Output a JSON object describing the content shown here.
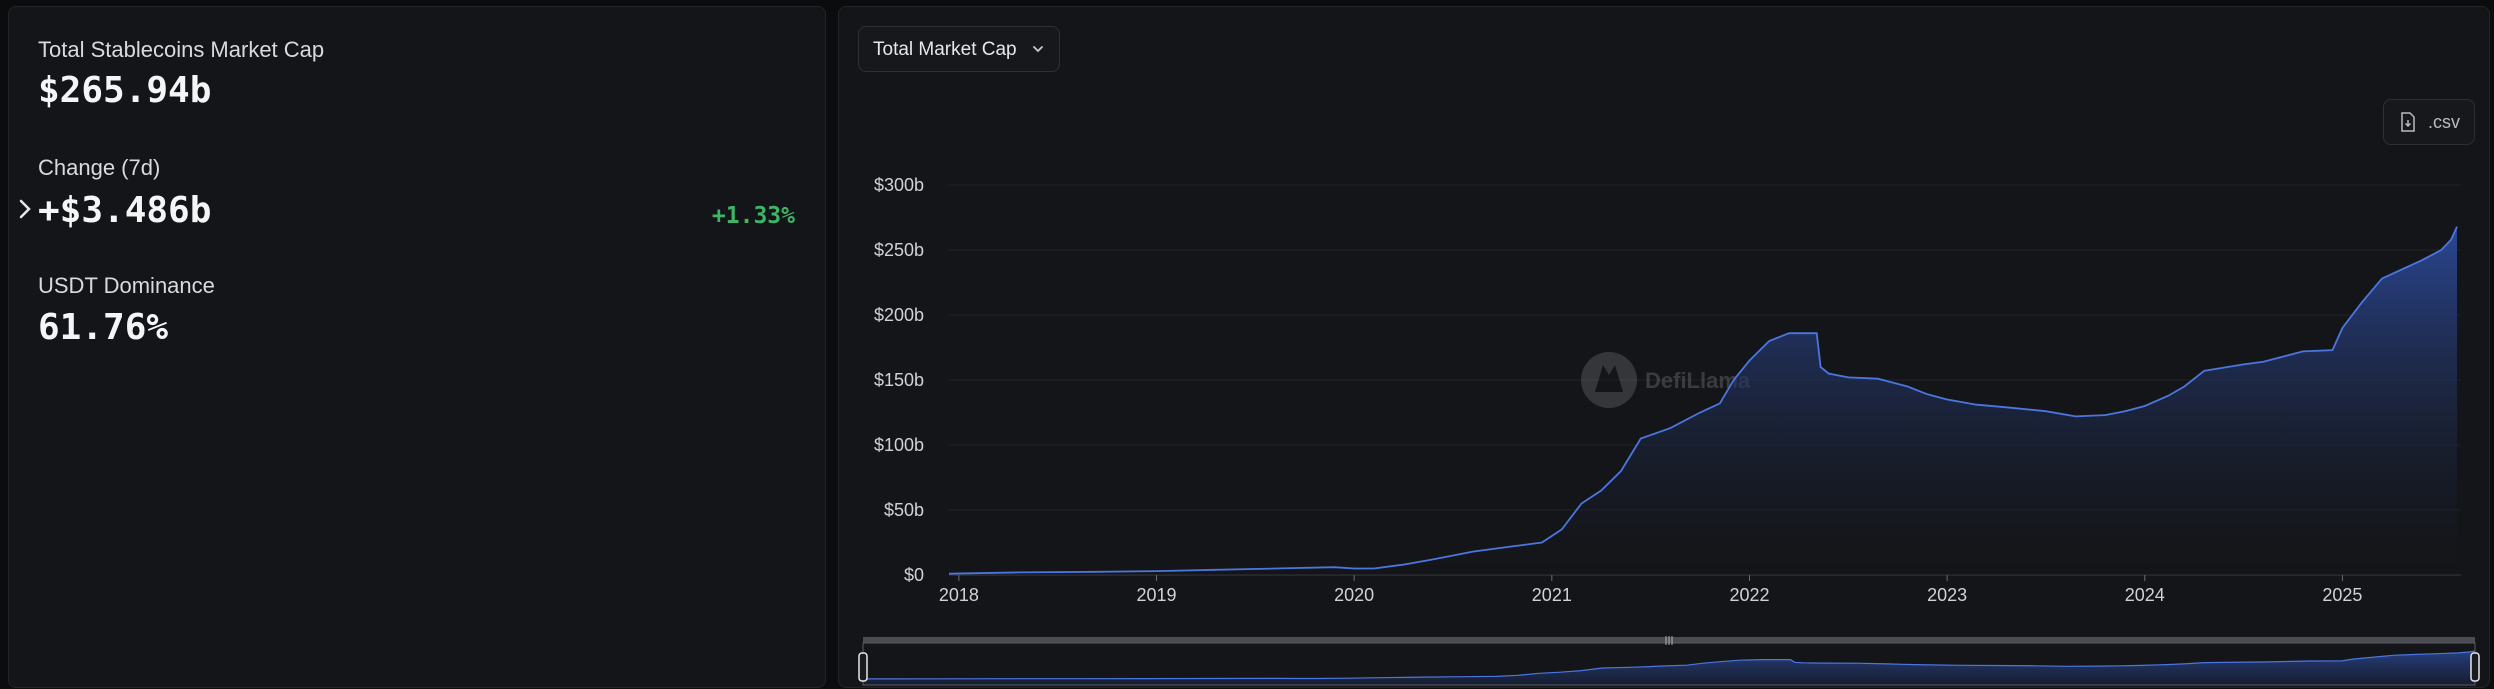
{
  "stats": {
    "market_cap_label": "Total Stablecoins Market Cap",
    "market_cap_value": "$265.94b",
    "change_label": "Change (7d)",
    "change_value": "+$3.486b",
    "change_pct": "+1.33%",
    "dominance_label": "USDT Dominance",
    "dominance_value": "61.76%"
  },
  "controls": {
    "metric_dropdown": "Total Market Cap",
    "csv_button": ".csv"
  },
  "watermark": "DefiLlama",
  "colors": {
    "line": "#4b76e0",
    "area_top": "#2c4a9a",
    "positive": "#3fb466"
  },
  "chart_data": {
    "type": "area",
    "title": "",
    "xlabel": "",
    "ylabel": "",
    "xlim": [
      2017.95,
      2025.6
    ],
    "ylim": [
      0,
      300
    ],
    "y_unit": "b",
    "y_ticks": [
      "$0",
      "$50b",
      "$100b",
      "$150b",
      "$200b",
      "$250b",
      "$300b"
    ],
    "x_ticks": [
      "2018",
      "2019",
      "2020",
      "2021",
      "2022",
      "2023",
      "2024",
      "2025"
    ],
    "grid": true,
    "legend": "none",
    "series": [
      {
        "x": [
          2017.95,
          2018.3,
          2018.7,
          2019.0,
          2019.3,
          2019.6,
          2019.9,
          2020.0,
          2020.1,
          2020.25,
          2020.4,
          2020.6,
          2020.8,
          2020.95,
          2021.05,
          2021.15,
          2021.25,
          2021.35,
          2021.45,
          2021.6,
          2021.75,
          2021.85,
          2021.92,
          2022.0,
          2022.1,
          2022.2,
          2022.3,
          2022.34,
          2022.36,
          2022.4,
          2022.5,
          2022.65,
          2022.8,
          2022.9,
          2023.0,
          2023.15,
          2023.3,
          2023.5,
          2023.65,
          2023.8,
          2023.9,
          2024.0,
          2024.12,
          2024.2,
          2024.3,
          2024.5,
          2024.6,
          2024.8,
          2024.95,
          2025.0,
          2025.1,
          2025.2,
          2025.3,
          2025.4,
          2025.5,
          2025.55,
          2025.58
        ],
        "values": [
          1,
          2,
          2.5,
          3,
          4,
          5,
          6,
          5,
          5,
          8,
          12,
          18,
          22,
          25,
          35,
          55,
          65,
          80,
          105,
          113,
          125,
          132,
          150,
          165,
          180,
          186,
          186,
          186,
          160,
          155,
          152,
          151,
          145,
          139,
          135,
          131,
          129,
          126,
          122,
          123,
          126,
          130,
          138,
          145,
          157,
          162,
          164,
          172,
          173,
          190,
          210,
          228,
          235,
          242,
          250,
          258,
          268
        ]
      }
    ],
    "brush": {
      "range": [
        "2018",
        "2025"
      ]
    }
  }
}
